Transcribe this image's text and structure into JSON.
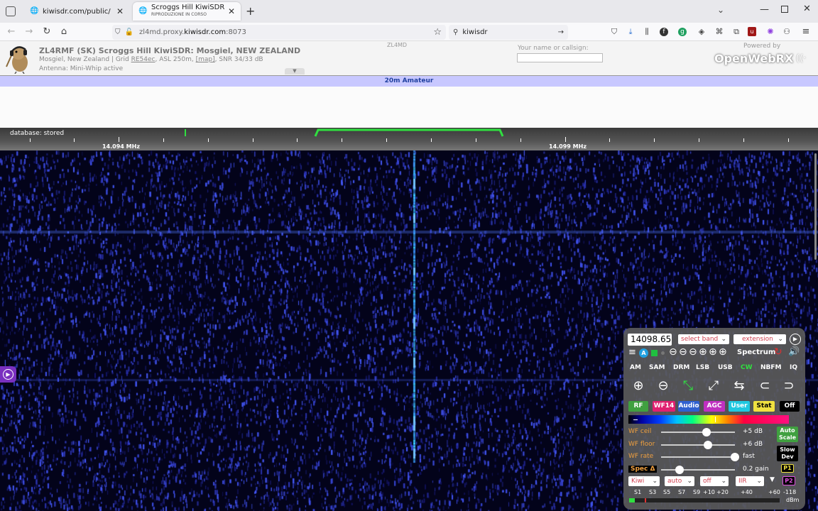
{
  "browser": {
    "tabs": [
      {
        "title": "kiwisdr.com/public/",
        "subtitle": ""
      },
      {
        "title": "Scroggs Hill KiwiSDR",
        "subtitle": "RIPRODUZIONE IN CORSO"
      }
    ],
    "new_tab": "+",
    "url_host": "zl4md.proxy.",
    "url_domain": "kiwisdr.com",
    "url_port": ":8073",
    "search_query": "kiwisdr"
  },
  "station": {
    "title": "ZL4RMF (SK) Scroggs Hill KiwiSDR: Mosgiel, NEW ZEALAND",
    "line2_prefix": "Mosgiel, New Zealand | Grid ",
    "grid": "RE54ec",
    "line2_mid": ", ASL 250m, ",
    "map": "[map]",
    "line2_suffix": ", SNR 34/33 dB",
    "antenna": "Antenna: Mini-Whip active",
    "callsign_center": "ZL4MD",
    "name_label": "Your name or callsign:",
    "name_value": "",
    "powered_by": "Powered by",
    "brand": "OpenWebRX"
  },
  "band_label": "20m Amateur",
  "scale": {
    "database": "database: stored",
    "freq_left": "14.094 MHz",
    "freq_right": "14.099 MHz"
  },
  "panel": {
    "frequency": "14098.65",
    "select_band": "select band",
    "extension": "extension",
    "spectrum": "Spectrum",
    "a_badge": "A",
    "modes": [
      "AM",
      "SAM",
      "DRM",
      "LSB",
      "USB",
      "CW",
      "NBFM",
      "IQ"
    ],
    "active_mode": "CW",
    "tabs": [
      {
        "label": "RF",
        "bg": "#40a040",
        "fg": "#fff"
      },
      {
        "label": "WF14",
        "bg": "#e02070",
        "fg": "#fff"
      },
      {
        "label": "Audio",
        "bg": "#3060d0",
        "fg": "#fff"
      },
      {
        "label": "AGC",
        "bg": "#c030c0",
        "fg": "#fff"
      },
      {
        "label": "User",
        "bg": "#20c8e0",
        "fg": "#fff"
      },
      {
        "label": "Stat",
        "bg": "#f0e040",
        "fg": "#000"
      },
      {
        "label": "Off",
        "bg": "#000",
        "fg": "#fff"
      }
    ],
    "sliders": [
      {
        "label": "WF ceil",
        "value": "+5 dB",
        "level": 0.62
      },
      {
        "label": "WF floor",
        "value": "+6 dB",
        "level": 0.63
      },
      {
        "label": "WF rate",
        "value": "fast",
        "level": 1.0
      },
      {
        "label": "Spec Δ",
        "value": "0.2 gain",
        "level": 0.25
      }
    ],
    "auto_scale": "Auto Scale",
    "slow_dev": "Slow Dev",
    "p1": "P1",
    "p2": "P2",
    "dropdowns": [
      "Kiwi",
      "auto",
      "off",
      "IIR"
    ],
    "smeter_labels": [
      "S1",
      "S3",
      "S5",
      "S7",
      "S9",
      "+10",
      "+20",
      "+40",
      "+60",
      "-118"
    ],
    "smeter_unit": "dBm"
  }
}
